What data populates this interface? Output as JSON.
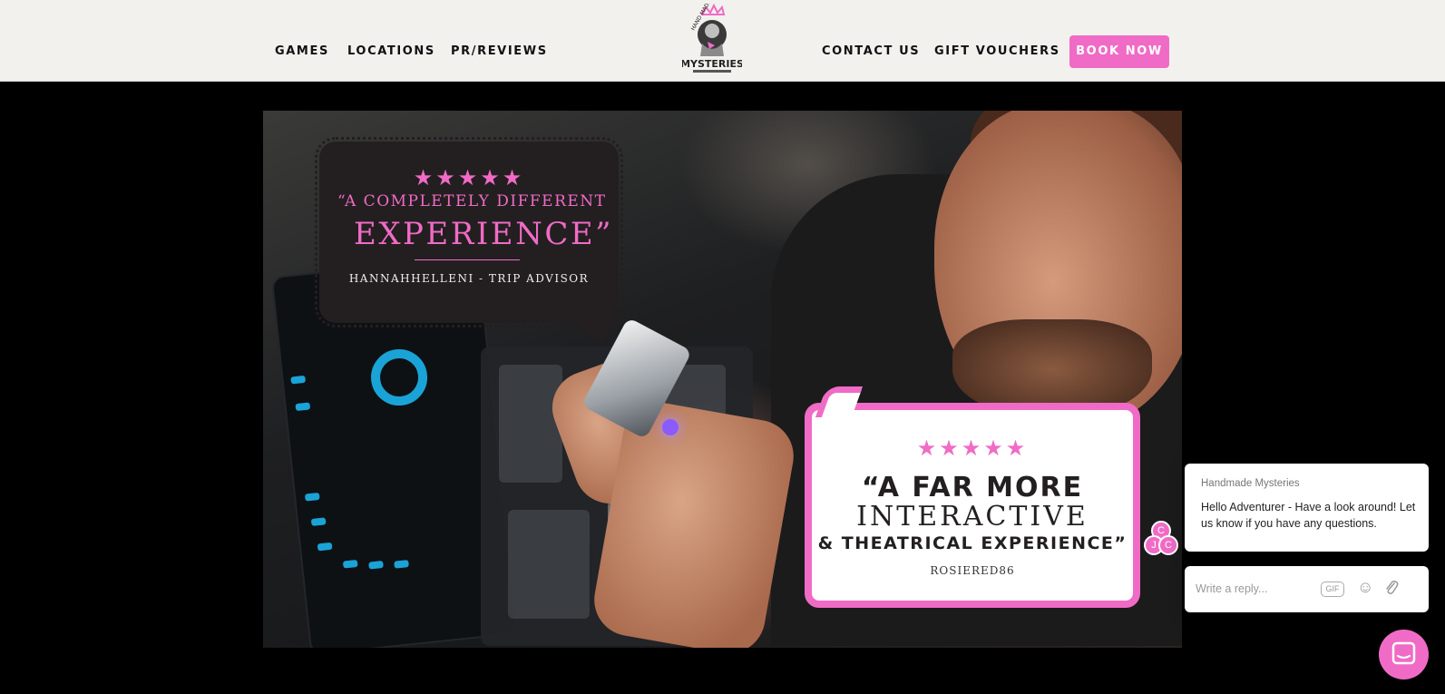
{
  "header": {
    "nav_left": [
      "GAMES",
      "LOCATIONS",
      "PR/REVIEWS"
    ],
    "nav_right": [
      "CONTACT US",
      "GIFT VOUCHERS"
    ],
    "book_label": "BOOK NOW",
    "logo": {
      "icon": "crowned-detective-logo-icon",
      "text_top": "HAND MADE",
      "text_main": "MYSTERIES"
    }
  },
  "hero": {
    "review1": {
      "stars": "★★★★★",
      "line1": "“A COMPLETELY DIFFERENT",
      "line2": "EXPERIENCE”",
      "source": "HANNAHHELLENI - TRIP ADVISOR"
    },
    "review2": {
      "stars": "★★★★★",
      "line1": "“A FAR MORE",
      "line2": "INTERACTIVE",
      "line3": "& THEATRICAL EXPERIENCE”",
      "source": "ROSIERED86"
    }
  },
  "chat": {
    "avatars": [
      "C",
      "J",
      "C"
    ],
    "sender": "Handmade Mysteries",
    "message": "Hello Adventurer - Have a look around! Let us know if you have any questions.",
    "reply_placeholder": "Write a reply...",
    "gif_label": "GIF",
    "icons": [
      "gif-icon",
      "emoji-icon",
      "attachment-icon",
      "chat-launcher-icon"
    ]
  },
  "colors": {
    "accent": "#f06bc6",
    "header_bg": "#f3f1ee",
    "page_bg": "#000000",
    "dark_bubble": "#231f20"
  }
}
